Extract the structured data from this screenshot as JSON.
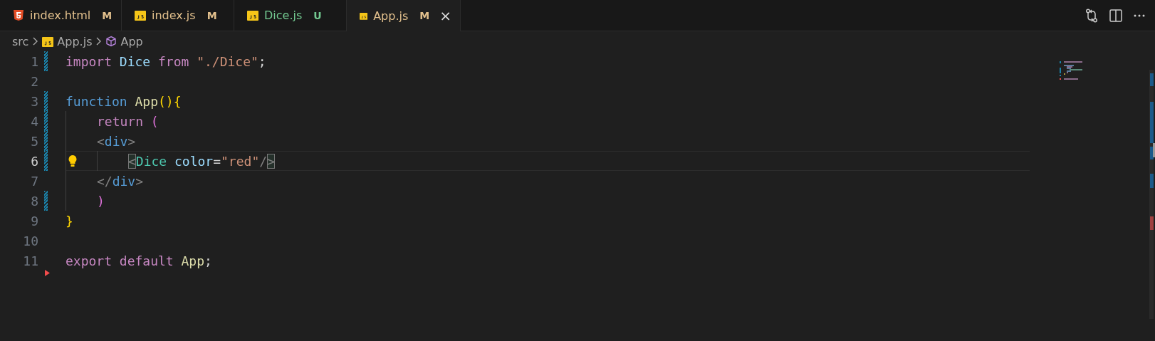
{
  "tabs": [
    {
      "label": "index.html",
      "kind": "html",
      "status": "M",
      "color": "#e2c08d",
      "selected": false
    },
    {
      "label": "index.js",
      "kind": "js",
      "status": "M",
      "color": "#e2c08d",
      "selected": false
    },
    {
      "label": "Dice.js",
      "kind": "js",
      "status": "U",
      "color": "#73c991",
      "selected": false
    },
    {
      "label": "App.js",
      "kind": "js",
      "status": "M",
      "color": "#e2c08d",
      "selected": true,
      "close": "×"
    }
  ],
  "actions": [
    {
      "kind": "compare"
    },
    {
      "kind": "split"
    },
    {
      "kind": "more"
    }
  ],
  "breadcrumb": [
    {
      "label": "src",
      "kind": "folder"
    },
    {
      "label": "App.js",
      "kind": "js"
    },
    {
      "label": "App",
      "kind": "symbol"
    }
  ],
  "editor": {
    "lines": [
      {
        "number": "1",
        "modified": true,
        "deleted": false,
        "current": false,
        "kind": "level0",
        "tokens": [
          {
            "text": "import",
            "kind": "keyword"
          },
          {
            "text": "Dice",
            "kind": "variable",
            "gap": true
          },
          {
            "text": "from",
            "kind": "keyword",
            "gap": true
          },
          {
            "text": "\"./Dice\"",
            "kind": "string",
            "gap": true
          },
          {
            "text": ";",
            "kind": "plain"
          }
        ]
      },
      {
        "number": "2",
        "modified": false,
        "deleted": false,
        "current": false,
        "kind": "level0"
      },
      {
        "number": "3",
        "modified": true,
        "deleted": false,
        "current": false,
        "kind": "level0",
        "tokens": [
          {
            "text": "function",
            "kind": "storage"
          },
          {
            "text": "App",
            "kind": "function",
            "gap": true
          },
          {
            "text": "(){",
            "kind": "bracket1"
          }
        ]
      },
      {
        "number": "4",
        "modified": true,
        "deleted": false,
        "current": false,
        "kind": "level1",
        "tokens": [
          {
            "text": "return",
            "kind": "keyword"
          },
          {
            "text": "(",
            "kind": "bracket2",
            "gap": true
          }
        ]
      },
      {
        "number": "5",
        "modified": true,
        "deleted": false,
        "current": false,
        "kind": "level1",
        "tokens": [
          {
            "text": "<",
            "kind": "punct"
          },
          {
            "text": "div",
            "kind": "tag"
          },
          {
            "text": ">",
            "kind": "punct"
          }
        ]
      },
      {
        "number": "6",
        "modified": true,
        "deleted": false,
        "current": true,
        "lightbulb": true,
        "kind": "level2",
        "tokens": [
          {
            "text": "<",
            "kind": "punct",
            "match": true
          },
          {
            "text": "Dice",
            "kind": "component"
          },
          {
            "text": "color",
            "kind": "attr",
            "gap": true
          },
          {
            "text": "=",
            "kind": "plain"
          },
          {
            "text": "\"red\"",
            "kind": "string"
          },
          {
            "text": "/",
            "kind": "punct"
          },
          {
            "text": ">",
            "kind": "punct",
            "match": true
          }
        ]
      },
      {
        "number": "7",
        "modified": false,
        "deleted": false,
        "current": false,
        "kind": "level1",
        "tokens": [
          {
            "text": "</",
            "kind": "punct"
          },
          {
            "text": "div",
            "kind": "tag"
          },
          {
            "text": ">",
            "kind": "punct"
          }
        ]
      },
      {
        "number": "8",
        "modified": true,
        "deleted": false,
        "current": false,
        "kind": "level1",
        "tokens": [
          {
            "text": ")",
            "kind": "bracket2"
          }
        ]
      },
      {
        "number": "9",
        "modified": false,
        "deleted": false,
        "current": false,
        "kind": "level0",
        "tokens": [
          {
            "text": "}",
            "kind": "bracket1"
          }
        ]
      },
      {
        "number": "10",
        "modified": false,
        "deleted": false,
        "current": false,
        "kind": "level0"
      },
      {
        "number": "11",
        "modified": false,
        "deleted": true,
        "current": false,
        "kind": "level0",
        "tokens": [
          {
            "text": "export",
            "kind": "keyword"
          },
          {
            "text": "default",
            "kind": "keyword",
            "gap": true
          },
          {
            "text": "App",
            "kind": "function",
            "gap": true
          },
          {
            "text": ";",
            "kind": "plain"
          }
        ]
      }
    ]
  }
}
